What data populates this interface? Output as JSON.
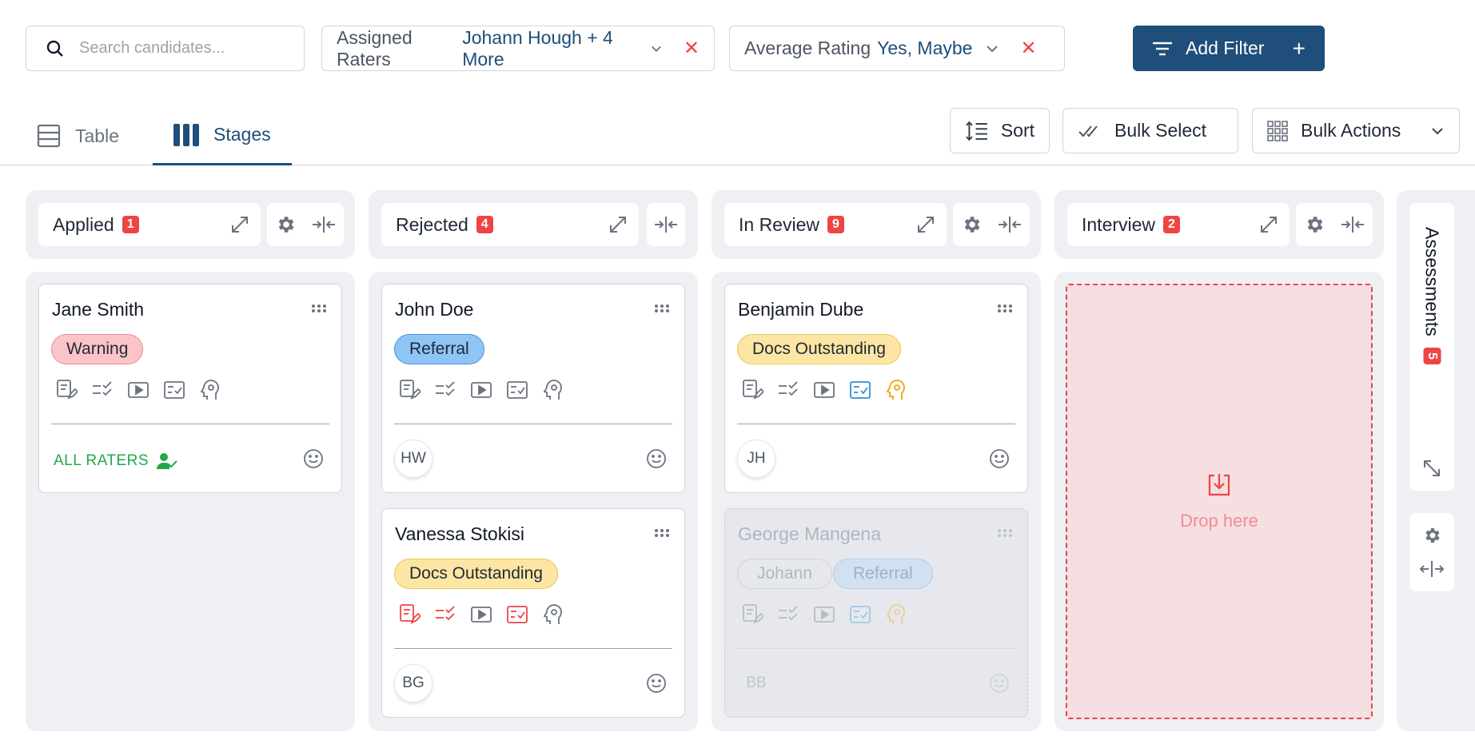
{
  "search": {
    "placeholder": "Search candidates..."
  },
  "filters": [
    {
      "label": "Assigned Raters",
      "value": "Johann Hough + 4 More"
    },
    {
      "label": "Average Rating",
      "value": "Yes, Maybe"
    }
  ],
  "add_filter_label": "Add Filter",
  "tabs": [
    {
      "label": "Table",
      "active": false
    },
    {
      "label": "Stages",
      "active": true
    }
  ],
  "toolbar": {
    "sort": "Sort",
    "bulk_select": "Bulk Select",
    "bulk_actions": "Bulk Actions"
  },
  "colors": {
    "primary": "#1e4e79",
    "danger": "#ef4444",
    "success": "#22a84a",
    "column_bg": "#eef0f4"
  },
  "columns": [
    {
      "title": "Applied",
      "count": "1",
      "cards": [
        {
          "name": "Jane Smith",
          "tag": "Warning",
          "footer": "ALL RATERS"
        }
      ]
    },
    {
      "title": "Rejected",
      "count": "4",
      "cards": [
        {
          "name": "John Doe",
          "tag": "Referral",
          "avatar": "HW"
        },
        {
          "name": "Vanessa Stokisi",
          "tag": "Docs Outstanding",
          "avatar": "BG"
        }
      ]
    },
    {
      "title": "In Review",
      "count": "9",
      "cards": [
        {
          "name": "Benjamin Dube",
          "tag": "Docs Outstanding",
          "avatar": "JH"
        }
      ],
      "dragging_card": {
        "name": "George Mangena",
        "tags": [
          "Johann",
          "Referral"
        ],
        "avatar": "BB"
      }
    },
    {
      "title": "Interview",
      "count": "2",
      "drop_text": "Drop here"
    }
  ],
  "collapsed_column": {
    "title": "Assessments",
    "count": "5"
  }
}
